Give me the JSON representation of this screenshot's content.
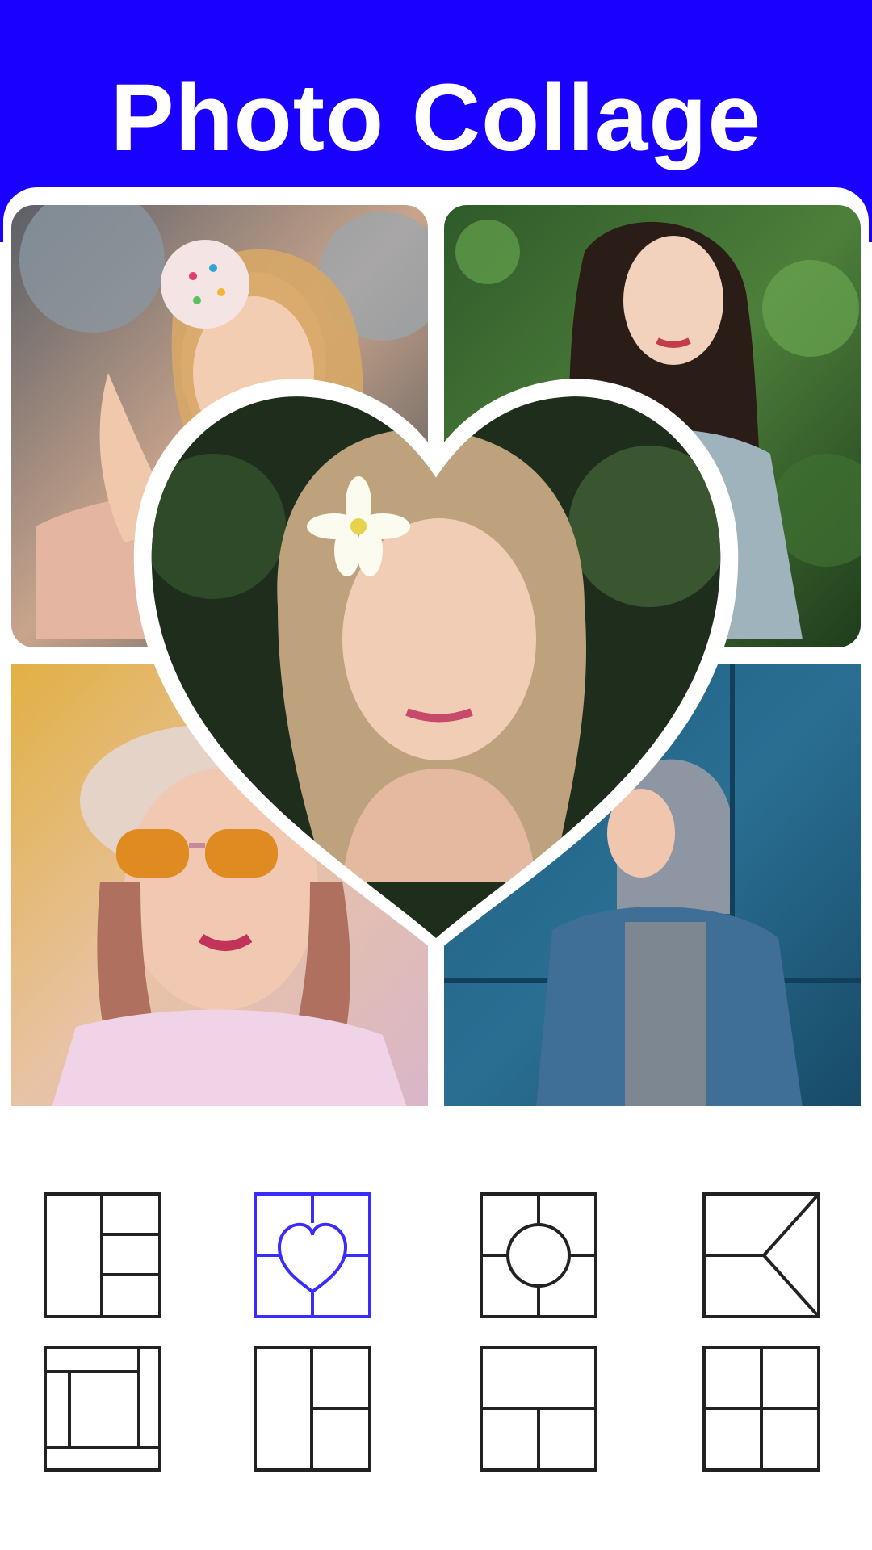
{
  "header": {
    "title": "Photo Collage",
    "background": "#1a00ff",
    "text_color": "#ffffff"
  },
  "collage": {
    "layout": "heart-center-four-grid",
    "photos": [
      "woman-holding-donut",
      "woman-against-leaves",
      "woman-with-flower-heart-center",
      "woman-orange-sunglasses",
      "woman-denim-jacket-hood"
    ]
  },
  "layout_picker": {
    "selected_color": "#3a2cff",
    "default_color": "#222222",
    "options": [
      {
        "id": "left-column-three-right",
        "selected": false
      },
      {
        "id": "heart-center",
        "selected": true
      },
      {
        "id": "circle-center",
        "selected": false
      },
      {
        "id": "arrow-split",
        "selected": false
      },
      {
        "id": "spiral-frames",
        "selected": false
      },
      {
        "id": "left-column-two-right",
        "selected": false
      },
      {
        "id": "top-wide-two-bottom",
        "selected": false
      },
      {
        "id": "four-grid",
        "selected": false
      }
    ]
  }
}
